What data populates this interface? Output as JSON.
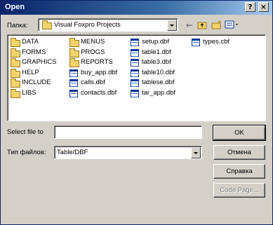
{
  "window": {
    "title": "Open",
    "help_label": "?",
    "close_label": "×"
  },
  "lookin": {
    "label": "Папка:",
    "value": "Visual Foxpro Projects"
  },
  "toolbar": {
    "back_icon": "back-arrow-icon",
    "up_icon": "up-folder-icon",
    "newfolder_icon": "new-folder-icon",
    "view_icon": "view-menu-icon"
  },
  "files": [
    {
      "name": "DATA",
      "type": "folder"
    },
    {
      "name": "FORMS",
      "type": "folder"
    },
    {
      "name": "GRAPHICS",
      "type": "folder"
    },
    {
      "name": "HELP",
      "type": "folder"
    },
    {
      "name": "INCLUDE",
      "type": "folder"
    },
    {
      "name": "LIBS",
      "type": "folder"
    },
    {
      "name": "MENUS",
      "type": "folder"
    },
    {
      "name": "PROGS",
      "type": "folder"
    },
    {
      "name": "REPORTS",
      "type": "folder"
    },
    {
      "name": "buy_app.dbf",
      "type": "table"
    },
    {
      "name": "calls.dbf",
      "type": "table"
    },
    {
      "name": "contacts.dbf",
      "type": "table"
    },
    {
      "name": "setup.dbf",
      "type": "table"
    },
    {
      "name": "table1.dbf",
      "type": "table"
    },
    {
      "name": "table3.dbf",
      "type": "table"
    },
    {
      "name": "table10.dbf",
      "type": "table"
    },
    {
      "name": "tablese.dbf",
      "type": "table"
    },
    {
      "name": "tar_app.dbf",
      "type": "table"
    },
    {
      "name": "types.cbf",
      "type": "table"
    }
  ],
  "filename": {
    "label": "Select file to",
    "value": ""
  },
  "filetype": {
    "label": "Тип файлов:",
    "value": "Table/DBF"
  },
  "buttons": {
    "ok": "OK",
    "cancel": "Отмена",
    "help": "Справка",
    "codepage": "Code Page..."
  }
}
